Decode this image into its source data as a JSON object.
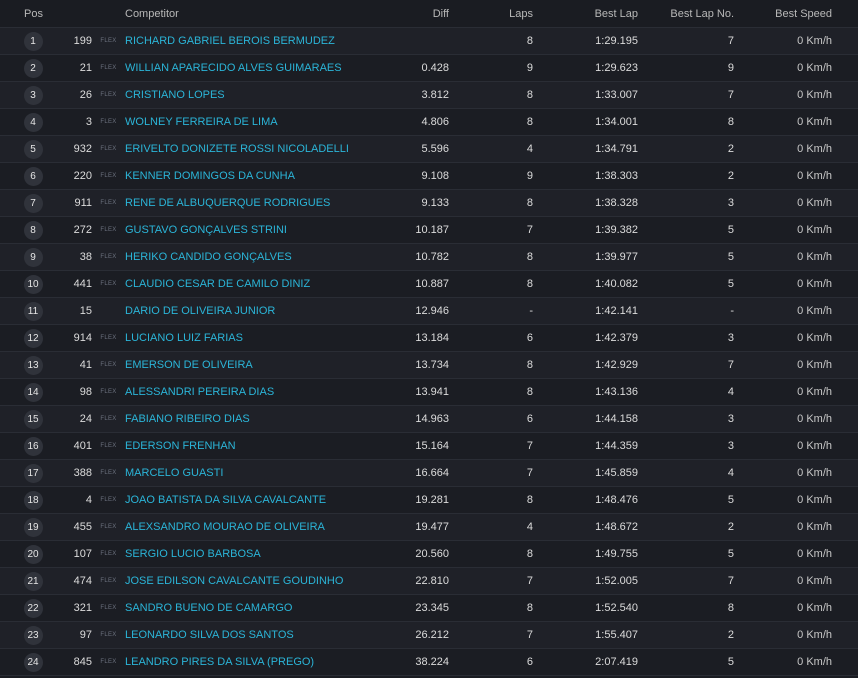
{
  "headers": {
    "pos": "Pos",
    "competitor": "Competitor",
    "diff": "Diff",
    "laps": "Laps",
    "best_lap": "Best Lap",
    "best_lap_no": "Best Lap No.",
    "best_speed": "Best Speed"
  },
  "rows": [
    {
      "pos": "1",
      "number": "199",
      "class": "FLEX",
      "name": "RICHARD GABRIEL BEROIS BERMUDEZ",
      "diff": "",
      "laps": "8",
      "best_lap": "1:29.195",
      "best_lap_no": "7",
      "best_speed": "0 Km/h"
    },
    {
      "pos": "2",
      "number": "21",
      "class": "FLEX",
      "name": "WILLIAN APARECIDO ALVES GUIMARAES",
      "diff": "0.428",
      "laps": "9",
      "best_lap": "1:29.623",
      "best_lap_no": "9",
      "best_speed": "0 Km/h"
    },
    {
      "pos": "3",
      "number": "26",
      "class": "FLEX",
      "name": "CRISTIANO LOPES",
      "diff": "3.812",
      "laps": "8",
      "best_lap": "1:33.007",
      "best_lap_no": "7",
      "best_speed": "0 Km/h"
    },
    {
      "pos": "4",
      "number": "3",
      "class": "FLEX",
      "name": "WOLNEY FERREIRA DE LIMA",
      "diff": "4.806",
      "laps": "8",
      "best_lap": "1:34.001",
      "best_lap_no": "8",
      "best_speed": "0 Km/h"
    },
    {
      "pos": "5",
      "number": "932",
      "class": "FLEX",
      "name": "ERIVELTO DONIZETE ROSSI NICOLADELLI",
      "diff": "5.596",
      "laps": "4",
      "best_lap": "1:34.791",
      "best_lap_no": "2",
      "best_speed": "0 Km/h"
    },
    {
      "pos": "6",
      "number": "220",
      "class": "FLEX",
      "name": "KENNER DOMINGOS DA CUNHA",
      "diff": "9.108",
      "laps": "9",
      "best_lap": "1:38.303",
      "best_lap_no": "2",
      "best_speed": "0 Km/h"
    },
    {
      "pos": "7",
      "number": "911",
      "class": "FLEX",
      "name": "RENE DE ALBUQUERQUE RODRIGUES",
      "diff": "9.133",
      "laps": "8",
      "best_lap": "1:38.328",
      "best_lap_no": "3",
      "best_speed": "0 Km/h"
    },
    {
      "pos": "8",
      "number": "272",
      "class": "FLEX",
      "name": "GUSTAVO GONÇALVES STRINI",
      "diff": "10.187",
      "laps": "7",
      "best_lap": "1:39.382",
      "best_lap_no": "5",
      "best_speed": "0 Km/h"
    },
    {
      "pos": "9",
      "number": "38",
      "class": "FLEX",
      "name": "HERIKO CANDIDO GONÇALVES",
      "diff": "10.782",
      "laps": "8",
      "best_lap": "1:39.977",
      "best_lap_no": "5",
      "best_speed": "0 Km/h"
    },
    {
      "pos": "10",
      "number": "441",
      "class": "FLEX",
      "name": "CLAUDIO CESAR DE CAMILO DINIZ",
      "diff": "10.887",
      "laps": "8",
      "best_lap": "1:40.082",
      "best_lap_no": "5",
      "best_speed": "0 Km/h"
    },
    {
      "pos": "11",
      "number": "15",
      "class": "",
      "name": "DARIO DE OLIVEIRA JUNIOR",
      "diff": "12.946",
      "laps": "-",
      "best_lap": "1:42.141",
      "best_lap_no": "-",
      "best_speed": "0 Km/h"
    },
    {
      "pos": "12",
      "number": "914",
      "class": "FLEX",
      "name": "LUCIANO LUIZ FARIAS",
      "diff": "13.184",
      "laps": "6",
      "best_lap": "1:42.379",
      "best_lap_no": "3",
      "best_speed": "0 Km/h"
    },
    {
      "pos": "13",
      "number": "41",
      "class": "FLEX",
      "name": "EMERSON DE OLIVEIRA",
      "diff": "13.734",
      "laps": "8",
      "best_lap": "1:42.929",
      "best_lap_no": "7",
      "best_speed": "0 Km/h"
    },
    {
      "pos": "14",
      "number": "98",
      "class": "FLEX",
      "name": "ALESSANDRI PEREIRA DIAS",
      "diff": "13.941",
      "laps": "8",
      "best_lap": "1:43.136",
      "best_lap_no": "4",
      "best_speed": "0 Km/h"
    },
    {
      "pos": "15",
      "number": "24",
      "class": "FLEX",
      "name": "FABIANO RIBEIRO DIAS",
      "diff": "14.963",
      "laps": "6",
      "best_lap": "1:44.158",
      "best_lap_no": "3",
      "best_speed": "0 Km/h"
    },
    {
      "pos": "16",
      "number": "401",
      "class": "FLEX",
      "name": "EDERSON FRENHAN",
      "diff": "15.164",
      "laps": "7",
      "best_lap": "1:44.359",
      "best_lap_no": "3",
      "best_speed": "0 Km/h"
    },
    {
      "pos": "17",
      "number": "388",
      "class": "FLEX",
      "name": "MARCELO GUASTI",
      "diff": "16.664",
      "laps": "7",
      "best_lap": "1:45.859",
      "best_lap_no": "4",
      "best_speed": "0 Km/h"
    },
    {
      "pos": "18",
      "number": "4",
      "class": "FLEX",
      "name": "JOAO BATISTA DA SILVA CAVALCANTE",
      "diff": "19.281",
      "laps": "8",
      "best_lap": "1:48.476",
      "best_lap_no": "5",
      "best_speed": "0 Km/h"
    },
    {
      "pos": "19",
      "number": "455",
      "class": "FLEX",
      "name": "ALEXSANDRO MOURAO DE OLIVEIRA",
      "diff": "19.477",
      "laps": "4",
      "best_lap": "1:48.672",
      "best_lap_no": "2",
      "best_speed": "0 Km/h"
    },
    {
      "pos": "20",
      "number": "107",
      "class": "FLEX",
      "name": "SERGIO LUCIO BARBOSA",
      "diff": "20.560",
      "laps": "8",
      "best_lap": "1:49.755",
      "best_lap_no": "5",
      "best_speed": "0 Km/h"
    },
    {
      "pos": "21",
      "number": "474",
      "class": "FLEX",
      "name": "JOSE EDILSON CAVALCANTE GOUDINHO",
      "diff": "22.810",
      "laps": "7",
      "best_lap": "1:52.005",
      "best_lap_no": "7",
      "best_speed": "0 Km/h"
    },
    {
      "pos": "22",
      "number": "321",
      "class": "FLEX",
      "name": "SANDRO BUENO DE CAMARGO",
      "diff": "23.345",
      "laps": "8",
      "best_lap": "1:52.540",
      "best_lap_no": "8",
      "best_speed": "0 Km/h"
    },
    {
      "pos": "23",
      "number": "97",
      "class": "FLEX",
      "name": "LEONARDO SILVA DOS SANTOS",
      "diff": "26.212",
      "laps": "7",
      "best_lap": "1:55.407",
      "best_lap_no": "2",
      "best_speed": "0 Km/h"
    },
    {
      "pos": "24",
      "number": "845",
      "class": "FLEX",
      "name": "LEANDRO PIRES DA SILVA (PREGO)",
      "diff": "38.224",
      "laps": "6",
      "best_lap": "2:07.419",
      "best_lap_no": "5",
      "best_speed": "0 Km/h"
    }
  ]
}
